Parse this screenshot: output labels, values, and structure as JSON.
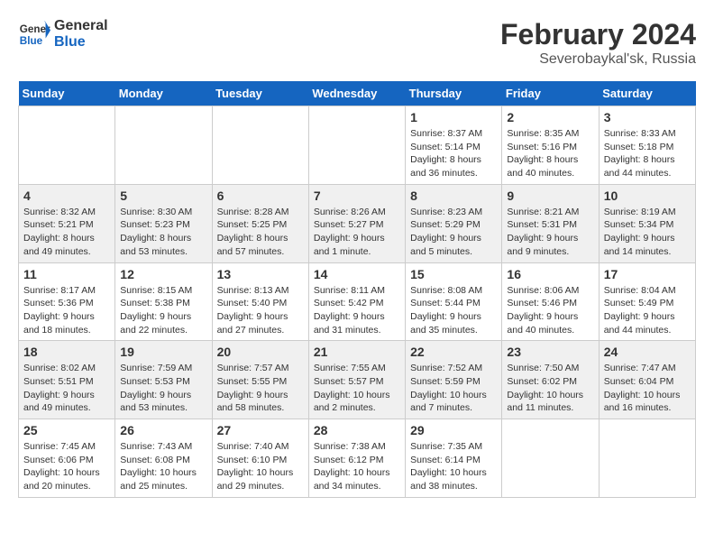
{
  "header": {
    "logo_text_general": "General",
    "logo_text_blue": "Blue",
    "month_year": "February 2024",
    "location": "Severobaykal'sk, Russia"
  },
  "weekdays": [
    "Sunday",
    "Monday",
    "Tuesday",
    "Wednesday",
    "Thursday",
    "Friday",
    "Saturday"
  ],
  "weeks": [
    [
      {
        "day": "",
        "info": ""
      },
      {
        "day": "",
        "info": ""
      },
      {
        "day": "",
        "info": ""
      },
      {
        "day": "",
        "info": ""
      },
      {
        "day": "1",
        "info": "Sunrise: 8:37 AM\nSunset: 5:14 PM\nDaylight: 8 hours\nand 36 minutes."
      },
      {
        "day": "2",
        "info": "Sunrise: 8:35 AM\nSunset: 5:16 PM\nDaylight: 8 hours\nand 40 minutes."
      },
      {
        "day": "3",
        "info": "Sunrise: 8:33 AM\nSunset: 5:18 PM\nDaylight: 8 hours\nand 44 minutes."
      }
    ],
    [
      {
        "day": "4",
        "info": "Sunrise: 8:32 AM\nSunset: 5:21 PM\nDaylight: 8 hours\nand 49 minutes."
      },
      {
        "day": "5",
        "info": "Sunrise: 8:30 AM\nSunset: 5:23 PM\nDaylight: 8 hours\nand 53 minutes."
      },
      {
        "day": "6",
        "info": "Sunrise: 8:28 AM\nSunset: 5:25 PM\nDaylight: 8 hours\nand 57 minutes."
      },
      {
        "day": "7",
        "info": "Sunrise: 8:26 AM\nSunset: 5:27 PM\nDaylight: 9 hours\nand 1 minute."
      },
      {
        "day": "8",
        "info": "Sunrise: 8:23 AM\nSunset: 5:29 PM\nDaylight: 9 hours\nand 5 minutes."
      },
      {
        "day": "9",
        "info": "Sunrise: 8:21 AM\nSunset: 5:31 PM\nDaylight: 9 hours\nand 9 minutes."
      },
      {
        "day": "10",
        "info": "Sunrise: 8:19 AM\nSunset: 5:34 PM\nDaylight: 9 hours\nand 14 minutes."
      }
    ],
    [
      {
        "day": "11",
        "info": "Sunrise: 8:17 AM\nSunset: 5:36 PM\nDaylight: 9 hours\nand 18 minutes."
      },
      {
        "day": "12",
        "info": "Sunrise: 8:15 AM\nSunset: 5:38 PM\nDaylight: 9 hours\nand 22 minutes."
      },
      {
        "day": "13",
        "info": "Sunrise: 8:13 AM\nSunset: 5:40 PM\nDaylight: 9 hours\nand 27 minutes."
      },
      {
        "day": "14",
        "info": "Sunrise: 8:11 AM\nSunset: 5:42 PM\nDaylight: 9 hours\nand 31 minutes."
      },
      {
        "day": "15",
        "info": "Sunrise: 8:08 AM\nSunset: 5:44 PM\nDaylight: 9 hours\nand 35 minutes."
      },
      {
        "day": "16",
        "info": "Sunrise: 8:06 AM\nSunset: 5:46 PM\nDaylight: 9 hours\nand 40 minutes."
      },
      {
        "day": "17",
        "info": "Sunrise: 8:04 AM\nSunset: 5:49 PM\nDaylight: 9 hours\nand 44 minutes."
      }
    ],
    [
      {
        "day": "18",
        "info": "Sunrise: 8:02 AM\nSunset: 5:51 PM\nDaylight: 9 hours\nand 49 minutes."
      },
      {
        "day": "19",
        "info": "Sunrise: 7:59 AM\nSunset: 5:53 PM\nDaylight: 9 hours\nand 53 minutes."
      },
      {
        "day": "20",
        "info": "Sunrise: 7:57 AM\nSunset: 5:55 PM\nDaylight: 9 hours\nand 58 minutes."
      },
      {
        "day": "21",
        "info": "Sunrise: 7:55 AM\nSunset: 5:57 PM\nDaylight: 10 hours\nand 2 minutes."
      },
      {
        "day": "22",
        "info": "Sunrise: 7:52 AM\nSunset: 5:59 PM\nDaylight: 10 hours\nand 7 minutes."
      },
      {
        "day": "23",
        "info": "Sunrise: 7:50 AM\nSunset: 6:02 PM\nDaylight: 10 hours\nand 11 minutes."
      },
      {
        "day": "24",
        "info": "Sunrise: 7:47 AM\nSunset: 6:04 PM\nDaylight: 10 hours\nand 16 minutes."
      }
    ],
    [
      {
        "day": "25",
        "info": "Sunrise: 7:45 AM\nSunset: 6:06 PM\nDaylight: 10 hours\nand 20 minutes."
      },
      {
        "day": "26",
        "info": "Sunrise: 7:43 AM\nSunset: 6:08 PM\nDaylight: 10 hours\nand 25 minutes."
      },
      {
        "day": "27",
        "info": "Sunrise: 7:40 AM\nSunset: 6:10 PM\nDaylight: 10 hours\nand 29 minutes."
      },
      {
        "day": "28",
        "info": "Sunrise: 7:38 AM\nSunset: 6:12 PM\nDaylight: 10 hours\nand 34 minutes."
      },
      {
        "day": "29",
        "info": "Sunrise: 7:35 AM\nSunset: 6:14 PM\nDaylight: 10 hours\nand 38 minutes."
      },
      {
        "day": "",
        "info": ""
      },
      {
        "day": "",
        "info": ""
      }
    ]
  ]
}
